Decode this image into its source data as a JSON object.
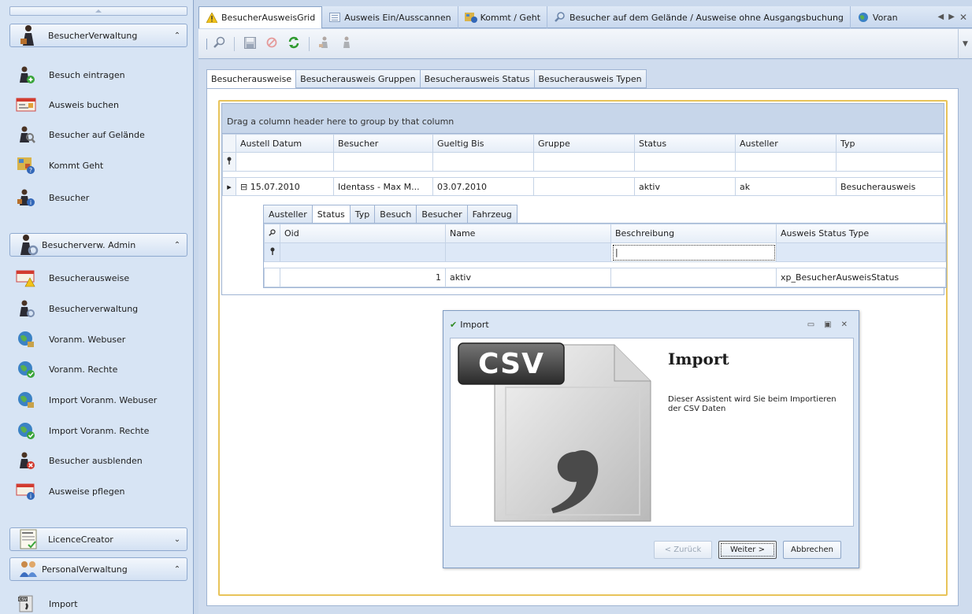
{
  "sidebar": {
    "groups": [
      {
        "label": "BesucherVerwaltung",
        "chevron": "⌃",
        "items": [
          {
            "label": "Besuch eintragen",
            "icon": "visitor-add-icon"
          },
          {
            "label": "Ausweis buchen",
            "icon": "badge-book-icon"
          },
          {
            "label": "Besucher auf Gelände",
            "icon": "visitor-search-icon"
          },
          {
            "label": "Kommt Geht",
            "icon": "come-go-icon"
          },
          {
            "label": "Besucher",
            "icon": "visitor-info-icon"
          }
        ]
      },
      {
        "label": "Besucherverw. Admin",
        "chevron": "⌃",
        "items": [
          {
            "label": "Besucherausweise",
            "icon": "badge-warning-icon"
          },
          {
            "label": "Besucherverwaltung",
            "icon": "visitor-admin-icon"
          },
          {
            "label": "Voranm. Webuser",
            "icon": "globe-lock-icon"
          },
          {
            "label": "Voranm. Rechte",
            "icon": "globe-check-icon"
          },
          {
            "label": "Import Voranm. Webuser",
            "icon": "globe-lock-icon"
          },
          {
            "label": "Import Voranm. Rechte",
            "icon": "globe-check-icon"
          },
          {
            "label": "Besucher ausblenden",
            "icon": "visitor-remove-icon"
          },
          {
            "label": "Ausweise pflegen",
            "icon": "badge-info-icon"
          }
        ]
      },
      {
        "label": "LicenceCreator",
        "chevron": "⌄"
      },
      {
        "label": "PersonalVerwaltung",
        "chevron": "⌃",
        "items": [
          {
            "label": "Import",
            "icon": "csv-import-icon"
          }
        ]
      }
    ]
  },
  "doc_tabs": [
    {
      "label": "BesucherAusweisGrid",
      "icon": "warning-icon",
      "active": true
    },
    {
      "label": "Ausweis Ein/Ausscannen",
      "icon": "list-icon"
    },
    {
      "label": "Kommt / Geht",
      "icon": "come-go-icon"
    },
    {
      "label": "Besucher auf dem Gelände / Ausweise ohne Ausgangsbuchung",
      "icon": "search-icon"
    },
    {
      "label": "Voran",
      "icon": "globe-icon"
    }
  ],
  "sub_tabs": [
    "Besucherausweise",
    "Besucherausweis Gruppen",
    "Besucherausweis Status",
    "Besucherausweis Typen"
  ],
  "grid": {
    "group_panel_text": "Drag a column header here to group by that column",
    "columns": [
      "Austell Datum",
      "Besucher",
      "Gueltig Bis",
      "Gruppe",
      "Status",
      "Austeller",
      "Typ"
    ],
    "rows": [
      {
        "expander": "⊟",
        "cells": [
          "15.07.2010",
          "Identass - Max M...",
          "03.07.2010",
          "",
          "aktiv",
          "ak",
          "Besucherausweis"
        ]
      }
    ]
  },
  "detail": {
    "tabs": [
      "Austeller",
      "Status",
      "Typ",
      "Besuch",
      "Besucher",
      "Fahrzeug"
    ],
    "active_tab": "Status",
    "columns": [
      "Oid",
      "Name",
      "Beschreibung",
      "Ausweis Status Type"
    ],
    "rows": [
      {
        "cells": [
          "1",
          "aktiv",
          "",
          "xp_BesucherAusweisStatus"
        ]
      }
    ]
  },
  "dialog": {
    "title": "Import",
    "heading": "Import",
    "text": "Dieser Assistent wird Sie beim Importieren der CSV Daten",
    "art_text": "CSV",
    "buttons": {
      "back": "< Zurück",
      "next": "Weiter >",
      "cancel": "Abbrechen"
    }
  }
}
